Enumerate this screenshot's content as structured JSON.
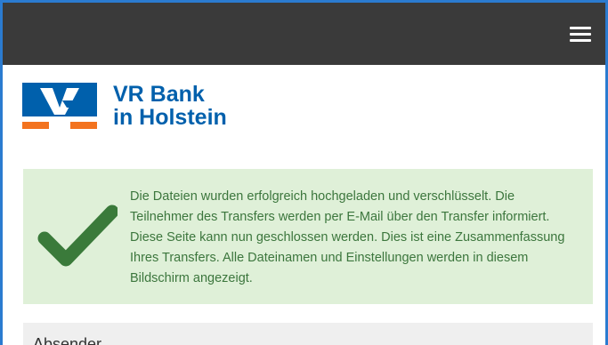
{
  "navbar": {
    "menu_icon": "hamburger-menu-icon"
  },
  "brand": {
    "line1": "VR Bank",
    "line2": "in Holstein",
    "logo_icon": "vr-bank-logo",
    "colors": {
      "blue": "#0060ac",
      "orange": "#f3731f"
    }
  },
  "alert": {
    "icon": "checkmark-icon",
    "message": "Die Dateien wurden erfolgreich hochgeladen und verschlüsselt. Die Teilnehmer des Transfers werden per E-Mail über den Transfer informiert. Diese Seite kann nun geschlossen werden. Dies ist eine Zusammenfassung Ihres Transfers. Alle Dateinamen und Einstellungen werden in diesem Bildschirm angezeigt.",
    "colors": {
      "background": "#dff0d8",
      "text": "#3c763d",
      "check": "#3a7a3a"
    }
  },
  "sender_panel": {
    "title": "Absender"
  }
}
